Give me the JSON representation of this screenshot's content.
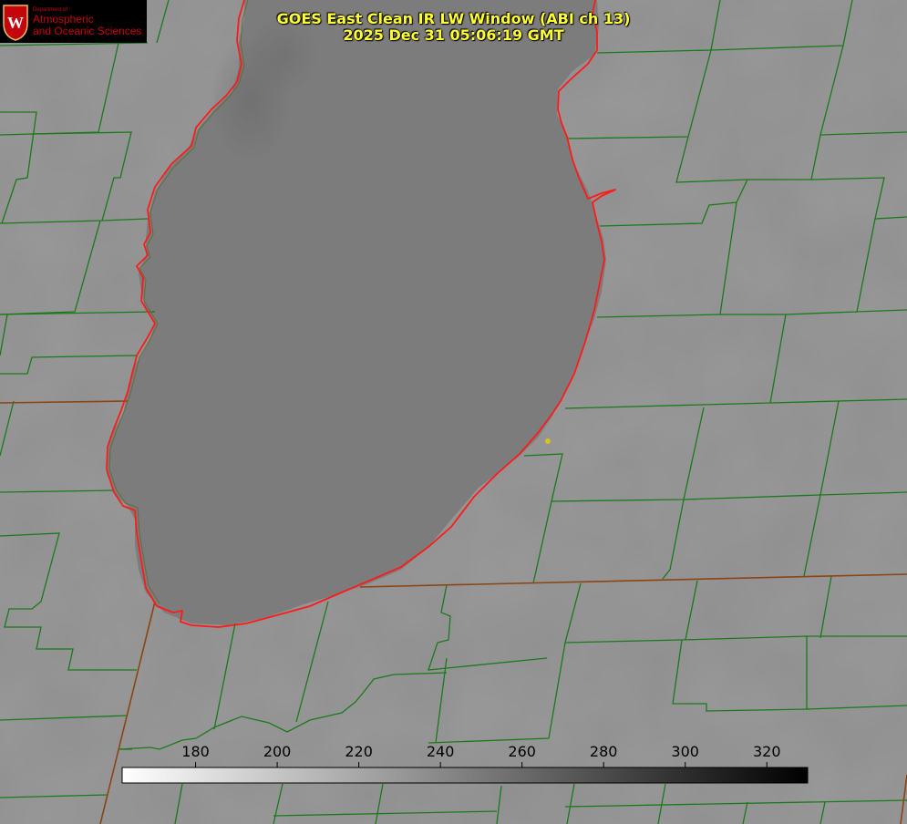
{
  "title": {
    "line1": "GOES East Clean IR LW Window (ABI ch 13)",
    "line2": "2025 Dec 31 05:06:19 GMT"
  },
  "logo": {
    "crest_letter": "W",
    "department": "Department of",
    "line1": "Atmospheric",
    "line2": "and Oceanic Sciences"
  },
  "colors": {
    "county_lines": "#1a7a1a",
    "state_lines": "#8b4513",
    "coastline": "#ff1a1a",
    "title": "#ffff33",
    "marker": "#d4c419",
    "logo_red": "#c5050c"
  },
  "colorbar": {
    "ticks": [
      "180",
      "200",
      "220",
      "240",
      "260",
      "280",
      "300",
      "320"
    ],
    "tick_values": [
      180,
      200,
      220,
      240,
      260,
      280,
      300,
      320
    ],
    "min": 162,
    "max": 330
  }
}
